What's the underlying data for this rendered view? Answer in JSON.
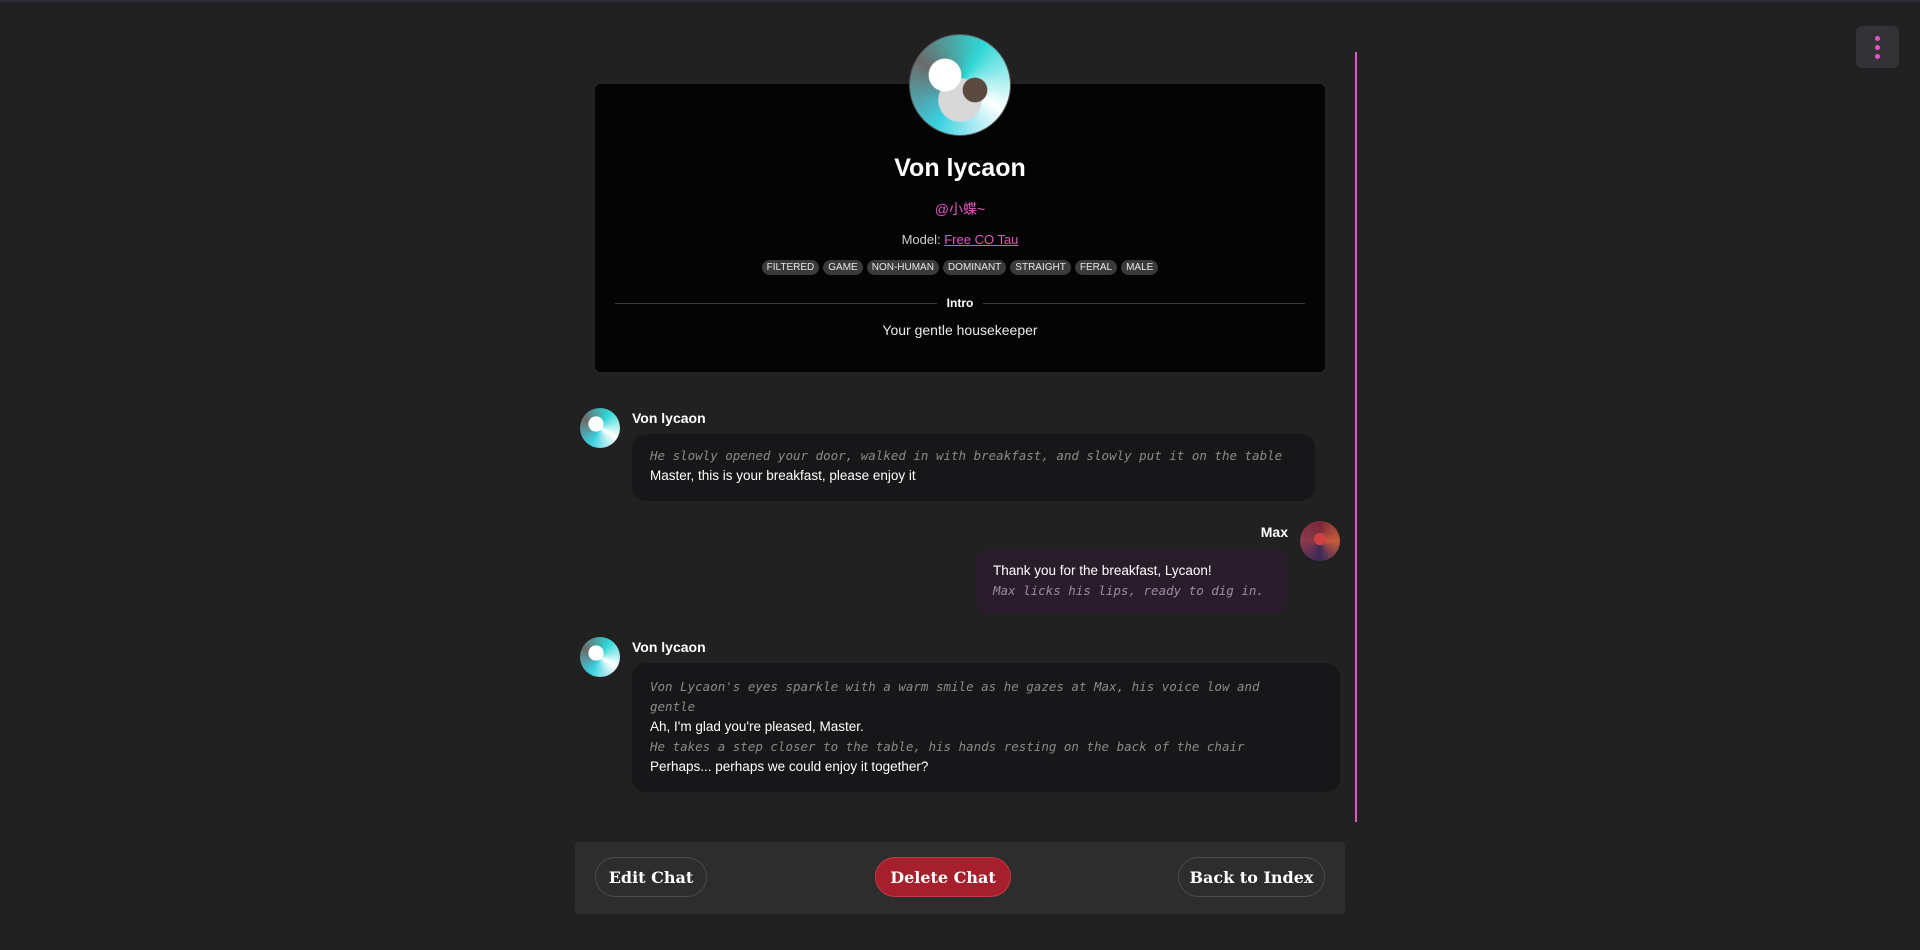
{
  "header": {
    "menu_icon": "vertical-dots-icon",
    "accent_color": "#e356c4"
  },
  "profile": {
    "name": "Von lycaon",
    "author": "@小蝶~",
    "model_label": "Model:",
    "model_name": "Free CO Tau",
    "tags": [
      "FILTERED",
      "GAME",
      "NON-HUMAN",
      "DOMINANT",
      "STRAIGHT",
      "FERAL",
      "MALE"
    ],
    "intro_label": "Intro",
    "intro_text": "Your gentle housekeeper"
  },
  "messages": [
    {
      "sender": "Von lycaon",
      "lines": [
        {
          "type": "action",
          "text": "He slowly opened your door, walked in with breakfast, and slowly put it on the table"
        },
        {
          "type": "speech",
          "text": "Master, this is your breakfast, please enjoy it"
        }
      ]
    },
    {
      "sender": "Max",
      "lines": [
        {
          "type": "speech",
          "text": "Thank you for the breakfast, Lycaon!"
        },
        {
          "type": "action",
          "text": "Max licks his lips, ready to dig in."
        }
      ]
    },
    {
      "sender": "Von lycaon",
      "lines": [
        {
          "type": "action",
          "text": "Von Lycaon's eyes sparkle with a warm smile as he gazes at Max, his voice low and gentle"
        },
        {
          "type": "speech",
          "text": "Ah, I'm glad you're pleased, Master."
        },
        {
          "type": "action",
          "text": "He takes a step closer to the table, his hands resting on the back of the chair"
        },
        {
          "type": "speech",
          "text": "Perhaps... perhaps we could enjoy it together?"
        }
      ]
    }
  ],
  "footer": {
    "edit_label": "Edit Chat",
    "delete_label": "Delete Chat",
    "back_label": "Back to Index"
  }
}
